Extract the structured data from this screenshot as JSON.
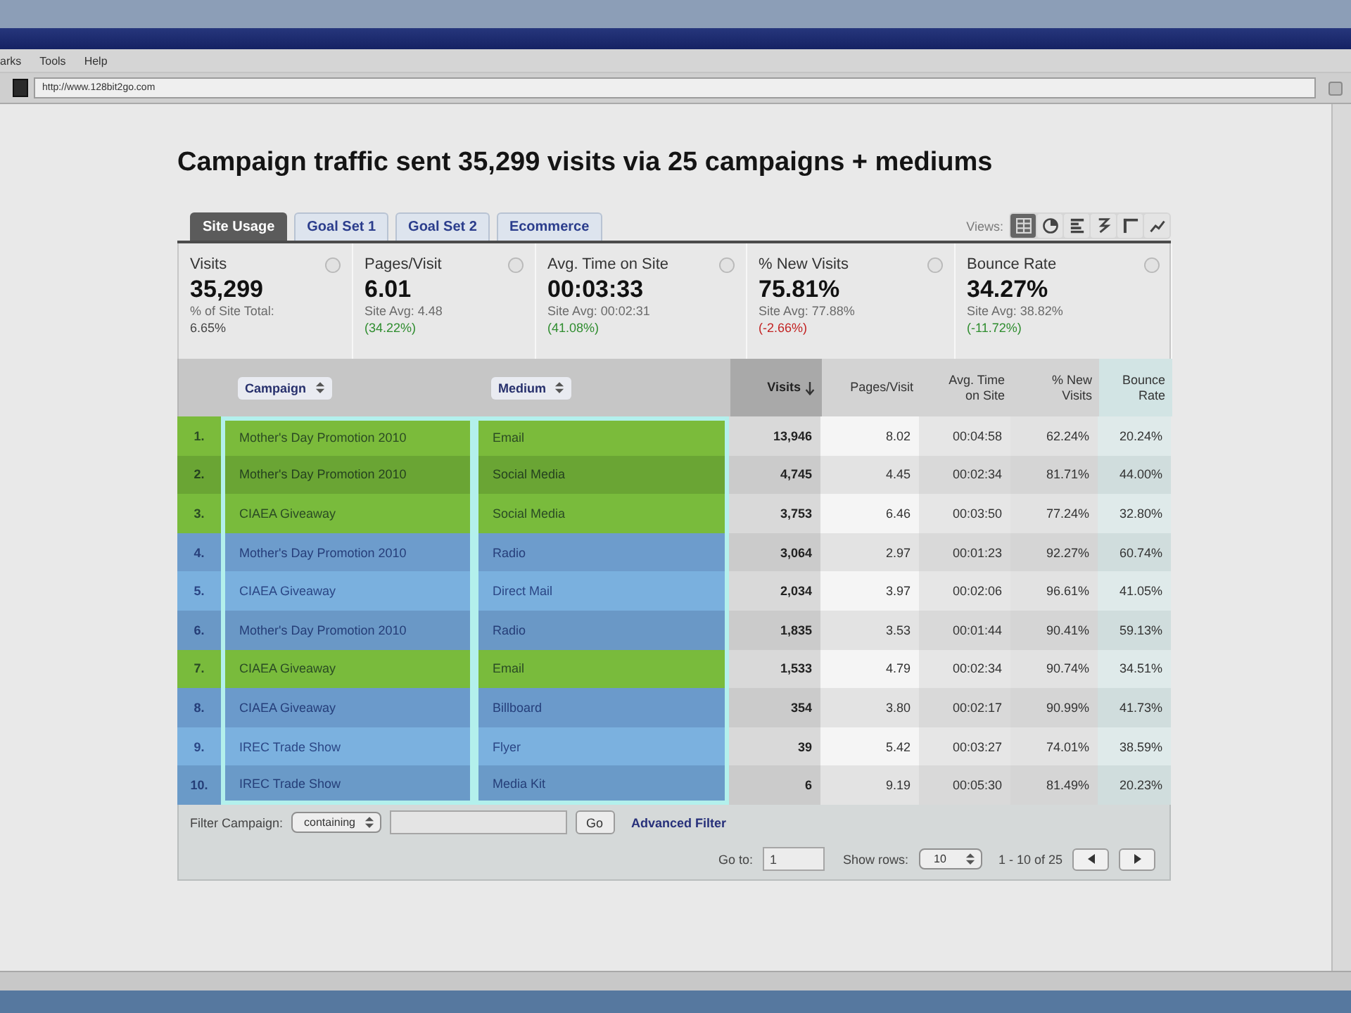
{
  "browser": {
    "menu": [
      "arks",
      "Tools",
      "Help"
    ],
    "address": "http://www.128bit2go.com"
  },
  "report": {
    "title": "Campaign traffic sent 35,299 visits via 25 campaigns + mediums",
    "tabs": [
      {
        "label": "Site Usage",
        "selected": true
      },
      {
        "label": "Goal Set 1",
        "selected": false
      },
      {
        "label": "Goal Set 2",
        "selected": false
      },
      {
        "label": "Ecommerce",
        "selected": false
      }
    ],
    "views": {
      "label": "Views:",
      "items": [
        {
          "kind": "table",
          "selected": true
        },
        {
          "kind": "pie",
          "selected": false
        },
        {
          "kind": "performance",
          "selected": false
        },
        {
          "kind": "pivot",
          "selected": false
        },
        {
          "kind": "comparison",
          "selected": false
        },
        {
          "kind": "trend",
          "selected": false
        }
      ]
    },
    "metrics": [
      {
        "label": "Visits",
        "value": "35,299",
        "note": "% of Site Total:",
        "detail": "6.65%",
        "color": "#444444"
      },
      {
        "label": "Pages/Visit",
        "value": "6.01",
        "note": "Site Avg: 4.48",
        "detail": "(34.22%)",
        "color": "#2f8d2f"
      },
      {
        "label": "Avg. Time on Site",
        "value": "00:03:33",
        "note": "Site Avg: 00:02:31",
        "detail": "(41.08%)",
        "color": "#2f8d2f"
      },
      {
        "label": "% New Visits",
        "value": "75.81%",
        "note": "Site Avg: 77.88%",
        "detail": "(-2.66%)",
        "color": "#c22222"
      },
      {
        "label": "Bounce Rate",
        "value": "34.27%",
        "note": "Site Avg: 38.82%",
        "detail": "(-11.72%)",
        "color": "#2f8d2f"
      }
    ],
    "table": {
      "columns": [
        {
          "label": "Campaign",
          "kind": "dimension",
          "sorted": false
        },
        {
          "label": "Medium",
          "kind": "dimension",
          "sorted": false
        },
        {
          "label": "Visits",
          "kind": "metric",
          "sorted": true
        },
        {
          "label": "Pages/Visit",
          "kind": "metric",
          "sorted": false
        },
        {
          "label": "Avg. Time on Site",
          "kind": "metric",
          "sorted": false
        },
        {
          "label": "% New Visits",
          "kind": "metric",
          "sorted": false
        },
        {
          "label": "Bounce Rate",
          "kind": "metric",
          "sorted": false
        }
      ],
      "rows": [
        {
          "index": "1.",
          "color": "#7bbb3b",
          "cells": [
            "Mother's Day Promotion 2010",
            "Email",
            "13,946",
            "8.02",
            "00:04:58",
            "62.24%",
            "20.24%"
          ]
        },
        {
          "index": "2.",
          "color": "#6aa534",
          "cells": [
            "Mother's Day Promotion 2010",
            "Social Media",
            "4,745",
            "4.45",
            "00:02:34",
            "81.71%",
            "44.00%"
          ]
        },
        {
          "index": "3.",
          "color": "#79bb3c",
          "cells": [
            "CIAEA Giveaway",
            "Social Media",
            "3,753",
            "6.46",
            "00:03:50",
            "77.24%",
            "32.80%"
          ]
        },
        {
          "index": "4.",
          "color": "#6d9ccc",
          "cells": [
            "Mother's Day Promotion 2010",
            "Radio",
            "3,064",
            "2.97",
            "00:01:23",
            "92.27%",
            "60.74%"
          ]
        },
        {
          "index": "5.",
          "color": "#7ab0de",
          "cells": [
            "CIAEA Giveaway",
            "Direct Mail",
            "2,034",
            "3.97",
            "00:02:06",
            "96.61%",
            "41.05%"
          ]
        },
        {
          "index": "6.",
          "color": "#6a98c6",
          "cells": [
            "Mother's Day Promotion 2010",
            "Radio",
            "1,835",
            "3.53",
            "00:01:44",
            "90.41%",
            "59.13%"
          ]
        },
        {
          "index": "7.",
          "color": "#79bb3c",
          "cells": [
            "CIAEA Giveaway",
            "Email",
            "1,533",
            "4.79",
            "00:02:34",
            "90.74%",
            "34.51%"
          ]
        },
        {
          "index": "8.",
          "color": "#6b9acb",
          "cells": [
            "CIAEA Giveaway",
            "Billboard",
            "354",
            "3.80",
            "00:02:17",
            "90.99%",
            "41.73%"
          ]
        },
        {
          "index": "9.",
          "color": "#7bb1df",
          "cells": [
            "IREC Trade Show",
            "Flyer",
            "39",
            "5.42",
            "00:03:27",
            "74.01%",
            "38.59%"
          ]
        },
        {
          "index": "10.",
          "color": "#6a9ac8",
          "cells": [
            "IREC Trade Show",
            "Media Kit",
            "6",
            "9.19",
            "00:05:30",
            "81.49%",
            "20.23%"
          ]
        }
      ]
    },
    "filter": {
      "label": "Filter Campaign:",
      "operator": "containing",
      "button": "Go",
      "advanced": "Advanced Filter"
    },
    "pager": {
      "goto_label": "Go to:",
      "goto_value": "1",
      "rows_label": "Show rows:",
      "rows_value": "10",
      "range": "1 - 10 of 25"
    }
  }
}
